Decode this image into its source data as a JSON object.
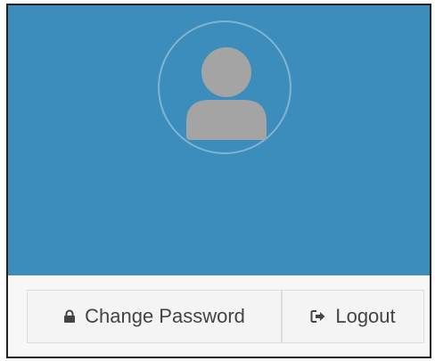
{
  "user_panel": {
    "avatar_icon": "user-avatar-icon"
  },
  "footer": {
    "change_password": {
      "label": "Change Password",
      "icon": "lock-icon"
    },
    "logout": {
      "label": "Logout",
      "icon": "sign-out-icon"
    }
  },
  "colors": {
    "header_bg": "#3c8dbc",
    "avatar_gray": "#a4a4a4",
    "button_bg": "#f4f4f4",
    "text": "#444444"
  }
}
